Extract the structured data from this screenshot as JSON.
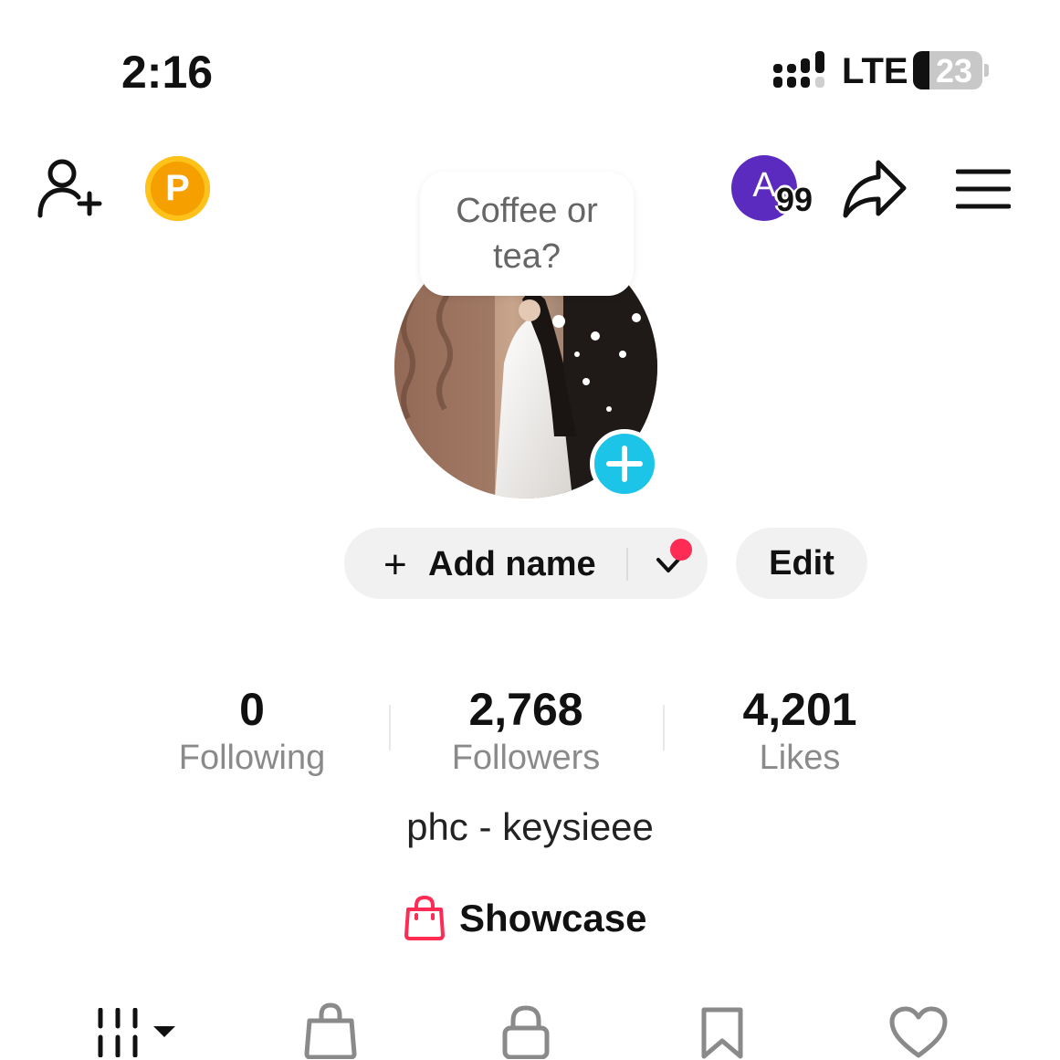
{
  "status_bar": {
    "time": "2:16",
    "network": "LTE",
    "battery": "23",
    "icons": [
      "signal-icon",
      "battery-icon"
    ]
  },
  "top_nav": {
    "coin_letter": "P",
    "inbox_avatar_letter": "A",
    "inbox_badge": "99",
    "icons": [
      "add-friend-icon",
      "coin-icon",
      "share-icon",
      "menu-icon"
    ]
  },
  "profile": {
    "note_bubble": "Coffee or tea?",
    "add_name_plus": "+",
    "add_name_label": "Add name",
    "edit_label": "Edit",
    "stats": [
      {
        "value": "0",
        "label": "Following"
      },
      {
        "value": "2,768",
        "label": "Followers"
      },
      {
        "value": "4,201",
        "label": "Likes"
      }
    ],
    "bio": "phc - keysieee",
    "showcase_label": "Showcase"
  },
  "tabs": {
    "icons": [
      "grid-videos-icon",
      "shop-bag-icon",
      "lock-icon",
      "bookmark-icon",
      "heart-icon"
    ]
  },
  "colors": {
    "accent_red": "#fe2c55",
    "add_photo_blue": "#1cc4e8",
    "avatar_purple": "#5b2bbf",
    "coin_orange": "#f5a000"
  }
}
